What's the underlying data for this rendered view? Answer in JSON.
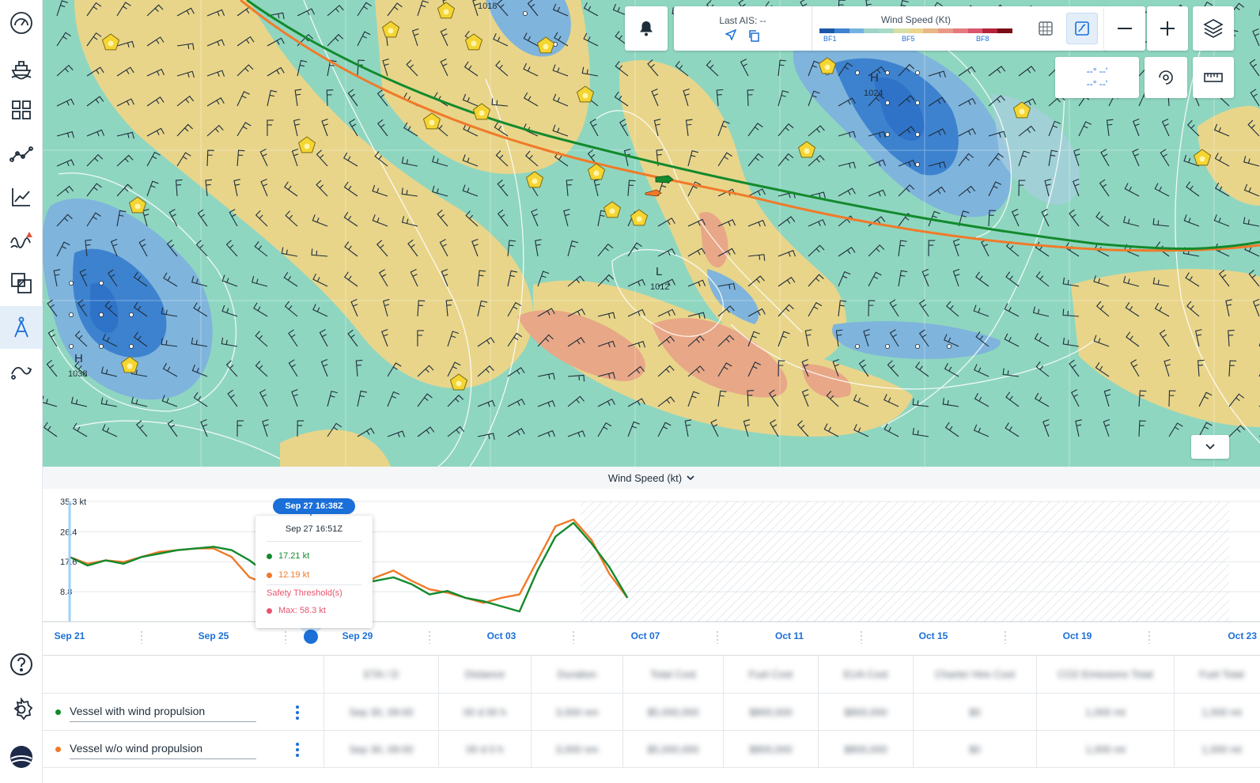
{
  "sidebar": {
    "items": [
      {
        "name": "speedometer-icon",
        "active": false
      },
      {
        "name": "ship-icon",
        "active": false
      },
      {
        "name": "dashboard-icon",
        "active": false
      },
      {
        "name": "route-icon",
        "active": false
      },
      {
        "name": "line-chart-icon",
        "active": false
      },
      {
        "name": "weather-alert-icon",
        "active": false
      },
      {
        "name": "layers-compare-icon",
        "active": false
      },
      {
        "name": "compass-icon",
        "active": true
      },
      {
        "name": "route-optimize-icon",
        "active": false
      }
    ],
    "bottom": [
      {
        "name": "help-icon"
      },
      {
        "name": "settings-icon"
      },
      {
        "name": "logo-icon"
      }
    ]
  },
  "map": {
    "pressure_labels": [
      {
        "letter": "H",
        "value": "1038"
      },
      {
        "letter": "H",
        "value": "1024"
      },
      {
        "letter": "L",
        "value": "1012"
      }
    ],
    "isobar_label": "1018",
    "coords_lat": "--° --'",
    "coords_lon": "--° --'",
    "colors": {
      "calm": "#8fd6c0",
      "moderate": "#e8d58a",
      "fresh": "#e8a787",
      "light_blue": "#7fb4dc",
      "deep_blue": "#2f73c8",
      "route_wind": "#138a2d",
      "route_no_wind": "#f07a2a"
    }
  },
  "ais": {
    "label": "Last AIS: --"
  },
  "legend": {
    "title": "Wind Speed (Kt)",
    "colors": [
      "#1b56a8",
      "#3f83d0",
      "#74b1de",
      "#9fd3c8",
      "#a8dbc5",
      "#d7e0a4",
      "#ecd58c",
      "#eab787",
      "#e99a86",
      "#e47a7f",
      "#d8566e",
      "#b5243b",
      "#7b0d18"
    ],
    "ticks": [
      "BF1",
      "BF5",
      "BF8"
    ]
  },
  "chart": {
    "panel_title": "Wind Speed (kt)",
    "time_badge": "Sep 27 16:38Z",
    "tooltip": {
      "time": "Sep 27 16:51Z",
      "green_value": "17.21 kt",
      "orange_value": "12.19 kt",
      "safety_label": "Safety Threshold(s)",
      "max_label": "Max: 58.3 kt"
    }
  },
  "chart_data": {
    "type": "line",
    "ylabel": "",
    "xlabel": "",
    "ytick_labels": [
      "35.3 kt",
      "26.4",
      "17.6",
      "8.8"
    ],
    "yticks": [
      35.3,
      26.4,
      17.6,
      8.8
    ],
    "ylim": [
      0,
      35.3
    ],
    "xtick_labels": [
      "Sep 21",
      "Sep 25",
      "Sep 29",
      "Oct 03",
      "Oct 07",
      "Oct 11",
      "Oct 15",
      "Oct 19",
      "Oct 23"
    ],
    "x_days": [
      0,
      4,
      8,
      12,
      16,
      20,
      24,
      28,
      32
    ],
    "forecast_end_day": 14.2,
    "series": [
      {
        "color": "#138a2d",
        "points": [
          [
            0,
            19
          ],
          [
            0.5,
            16.5
          ],
          [
            1,
            18
          ],
          [
            1.5,
            17
          ],
          [
            2,
            19
          ],
          [
            2.5,
            20
          ],
          [
            3,
            21
          ],
          [
            3.5,
            21.5
          ],
          [
            4,
            22
          ],
          [
            4.5,
            21
          ],
          [
            5,
            18
          ],
          [
            5.5,
            14
          ],
          [
            6,
            13.5
          ],
          [
            6.5,
            15
          ],
          [
            7,
            13
          ],
          [
            7.5,
            11.5
          ],
          [
            8,
            11
          ],
          [
            8.5,
            12
          ],
          [
            9,
            13
          ],
          [
            9.5,
            11
          ],
          [
            10,
            8
          ],
          [
            10.5,
            9
          ],
          [
            11,
            7
          ],
          [
            11.5,
            6
          ],
          [
            12,
            4.5
          ],
          [
            12.5,
            3
          ],
          [
            13,
            15
          ],
          [
            13.5,
            25
          ],
          [
            14,
            29
          ],
          [
            14.5,
            23
          ],
          [
            15,
            16
          ],
          [
            15.5,
            7
          ]
        ]
      },
      {
        "color": "#f07a2a",
        "points": [
          [
            0,
            19
          ],
          [
            0.5,
            17
          ],
          [
            1,
            18
          ],
          [
            1.5,
            17.5
          ],
          [
            2,
            19
          ],
          [
            2.5,
            20.5
          ],
          [
            3,
            21
          ],
          [
            3.5,
            21.5
          ],
          [
            4,
            21.5
          ],
          [
            4.5,
            19
          ],
          [
            5,
            13
          ],
          [
            5.5,
            11
          ],
          [
            6,
            14
          ],
          [
            6.5,
            16
          ],
          [
            7,
            13
          ],
          [
            7.5,
            12
          ],
          [
            8,
            10
          ],
          [
            8.5,
            13
          ],
          [
            9,
            15
          ],
          [
            9.5,
            12
          ],
          [
            10,
            9.5
          ],
          [
            10.5,
            8.5
          ],
          [
            11,
            7
          ],
          [
            11.5,
            5.5
          ],
          [
            12,
            7
          ],
          [
            12.5,
            8
          ],
          [
            13,
            18
          ],
          [
            13.5,
            28
          ],
          [
            14,
            30
          ],
          [
            14.5,
            24
          ],
          [
            15,
            14
          ],
          [
            15.5,
            7
          ]
        ]
      }
    ]
  },
  "table": {
    "headers": [
      "ETA / D",
      "Distance",
      "Duration",
      "Total Cost",
      "Fuel Cost",
      "EUA Cost",
      "Charter Hire Cost",
      "CO2 Emissions Total",
      "Fuel Total"
    ],
    "rows": [
      {
        "name": "Vessel with wind propulsion",
        "color": "#138a2d",
        "cells": [
          "Sep 30, 09:00",
          "00 d 00 h",
          "3,000 nm",
          "$5,000,000",
          "$800,000",
          "$800,000",
          "$0",
          "1,000 mt",
          "1,000 mt"
        ]
      },
      {
        "name": "Vessel w/o wind propulsion",
        "color": "#f07a2a",
        "cells": [
          "Sep 30, 09:00",
          "00 d 0 h",
          "3,000 nm",
          "$5,000,000",
          "$800,000",
          "$800,000",
          "$0",
          "1,000 mt",
          "1,000 mt"
        ]
      }
    ]
  }
}
